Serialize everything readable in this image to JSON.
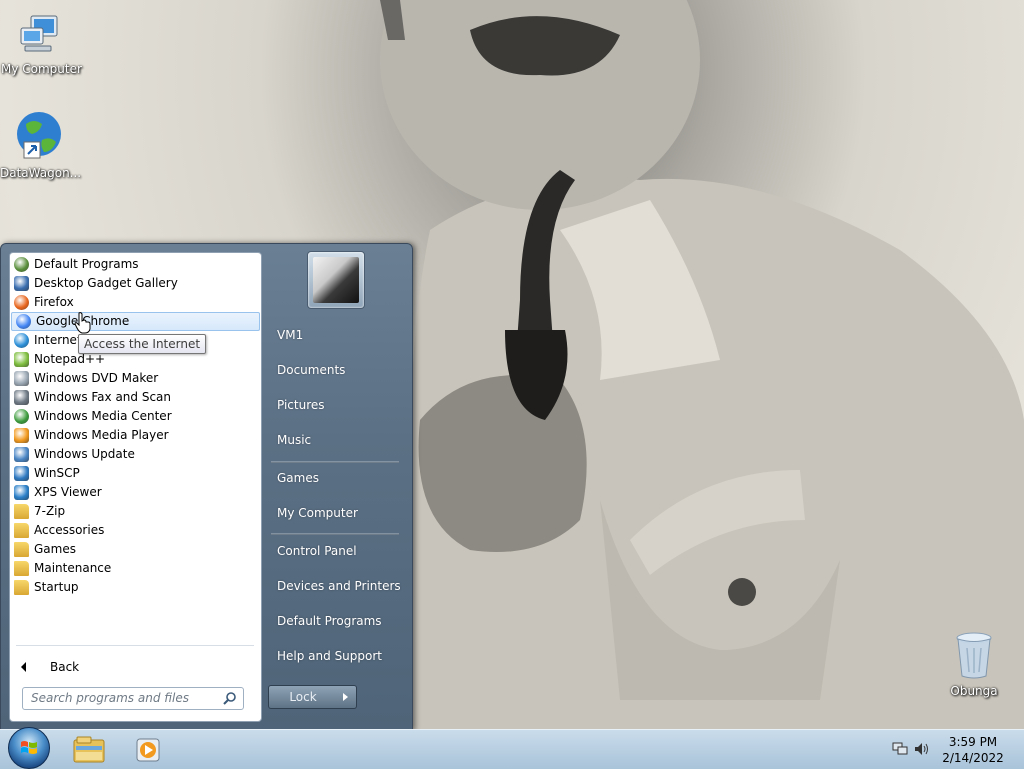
{
  "desktop": {
    "icons": [
      {
        "label": "My Computer",
        "icon": "computer-icon"
      },
      {
        "label": "DataWagon...",
        "icon": "globe-shortcut-icon"
      },
      {
        "label": "Obunga",
        "icon": "recycle-bin-icon"
      }
    ]
  },
  "start_menu": {
    "programs": [
      {
        "label": "Default Programs",
        "icon": "default-programs-icon",
        "color": "#5a8f3c"
      },
      {
        "label": "Desktop Gadget Gallery",
        "icon": "gadget-gallery-icon",
        "color": "#3b6fb0"
      },
      {
        "label": "Firefox",
        "icon": "firefox-icon",
        "color": "#e8651c"
      },
      {
        "label": "Google Chrome",
        "icon": "chrome-icon",
        "color": "#4285f4"
      },
      {
        "label": "Internet",
        "icon": "internet-explorer-icon",
        "color": "#2b8fd8"
      },
      {
        "label": "Notepad++",
        "icon": "notepad-plus-plus-icon",
        "color": "#7fbf3f"
      },
      {
        "label": "Windows DVD Maker",
        "icon": "dvd-maker-icon",
        "color": "#9aa7b3"
      },
      {
        "label": "Windows Fax and Scan",
        "icon": "fax-scan-icon",
        "color": "#6f7a85"
      },
      {
        "label": "Windows Media Center",
        "icon": "media-center-icon",
        "color": "#3d9b3d"
      },
      {
        "label": "Windows Media Player",
        "icon": "media-player-icon",
        "color": "#f29a1f"
      },
      {
        "label": "Windows Update",
        "icon": "windows-update-icon",
        "color": "#4a86c5"
      },
      {
        "label": "WinSCP",
        "icon": "winscp-icon",
        "color": "#2f7ac2"
      },
      {
        "label": "XPS Viewer",
        "icon": "xps-viewer-icon",
        "color": "#2a7fc8"
      },
      {
        "label": "7-Zip",
        "icon": "folder-icon",
        "color": "#e3b94a"
      },
      {
        "label": "Accessories",
        "icon": "folder-icon",
        "color": "#e3b94a"
      },
      {
        "label": "Games",
        "icon": "folder-icon",
        "color": "#e3b94a"
      },
      {
        "label": "Maintenance",
        "icon": "folder-icon",
        "color": "#e3b94a"
      },
      {
        "label": "Startup",
        "icon": "folder-icon",
        "color": "#e3b94a"
      }
    ],
    "highlighted": "Google Chrome",
    "tooltip": "Access the Internet",
    "back_label": "Back",
    "search_placeholder": "Search programs and files",
    "right_items": [
      {
        "label": "VM1"
      },
      {
        "label": "Documents"
      },
      {
        "label": "Pictures"
      },
      {
        "label": "Music"
      },
      {
        "label": "Games"
      },
      {
        "label": "My Computer"
      },
      {
        "label": "Control Panel"
      },
      {
        "label": "Devices and Printers"
      },
      {
        "label": "Default Programs"
      },
      {
        "label": "Help and Support"
      }
    ],
    "lock_label": "Lock"
  },
  "taskbar": {
    "pinned": [
      {
        "icon": "windows-explorer-icon"
      },
      {
        "icon": "media-player-icon"
      }
    ],
    "tray": [
      {
        "icon": "network-icon"
      },
      {
        "icon": "volume-icon"
      }
    ],
    "clock": {
      "time": "3:59 PM",
      "date": "2/14/2022"
    }
  }
}
